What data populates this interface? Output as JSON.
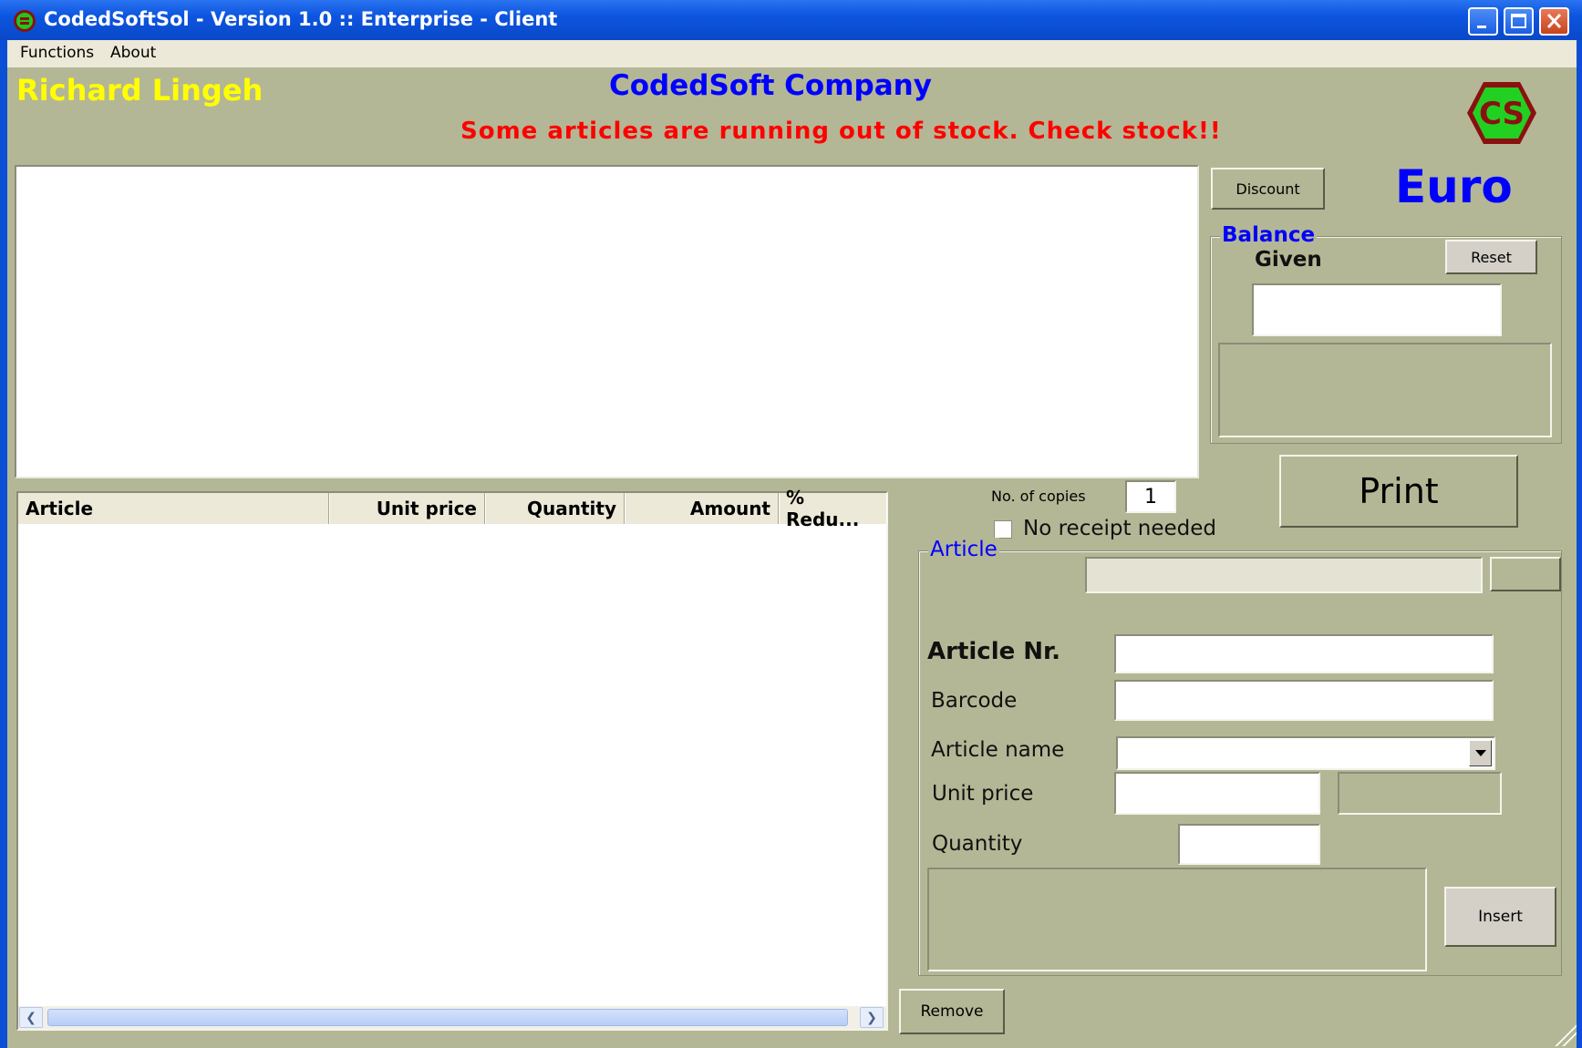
{
  "window": {
    "title": "CodedSoftSol - Version 1.0 :: Enterprise - Client"
  },
  "menu": {
    "items": [
      {
        "label": "Functions"
      },
      {
        "label": "About"
      }
    ]
  },
  "header": {
    "user_name": "Richard Lingeh",
    "company": "CodedSoft Company",
    "warning": "Some articles are running out of stock. Check stock!!",
    "logo_text": "CS"
  },
  "currency": "Euro",
  "buttons": {
    "discount": "Discount",
    "reset": "Reset",
    "print": "Print",
    "insert": "Insert",
    "remove": "Remove"
  },
  "balance": {
    "legend": "Balance",
    "given_label": "Given",
    "given_value": ""
  },
  "receipt": {
    "copies_label": "No. of copies",
    "copies_value": "1",
    "no_receipt_label": "No receipt needed",
    "no_receipt_checked": false
  },
  "table": {
    "columns": [
      "Article",
      "Unit price",
      "Quantity",
      "Amount",
      "% Redu..."
    ],
    "rows": []
  },
  "article": {
    "legend": "Article",
    "fields": {
      "article_nr": {
        "label": "Article Nr.",
        "value": ""
      },
      "barcode": {
        "label": "Barcode",
        "value": ""
      },
      "article_name": {
        "label": "Article name",
        "value": ""
      },
      "unit_price": {
        "label": "Unit price",
        "value": ""
      },
      "quantity": {
        "label": "Quantity",
        "value": ""
      }
    }
  },
  "colors": {
    "background": "#b4b795",
    "user_name": "#ffff00",
    "company": "#0000ff",
    "warning": "#ff0000",
    "titlebar": "#0a4fd6"
  },
  "icons": {
    "app": "cs-logo-icon",
    "minimize": "minimize-icon",
    "maximize": "maximize-icon",
    "close": "close-icon",
    "dropdown": "chevron-down-icon",
    "scroll_left": "chevron-left-icon",
    "scroll_right": "chevron-right-icon"
  }
}
